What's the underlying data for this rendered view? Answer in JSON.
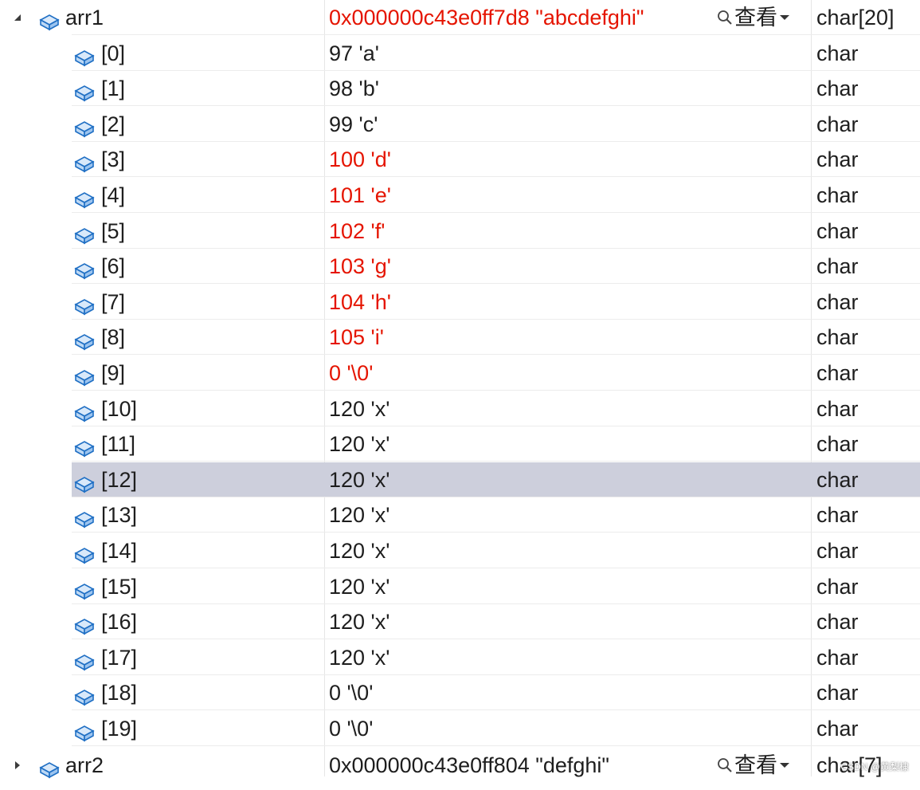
{
  "parent": {
    "name": "arr1",
    "value": "0x000000c43e0ff7d8 \"abcdefghi\"",
    "view_label": "查看",
    "type": "char[20]",
    "expanded": true
  },
  "children": [
    {
      "name": "[0]",
      "value": "97 'a'",
      "type": "char",
      "changed": false
    },
    {
      "name": "[1]",
      "value": "98 'b'",
      "type": "char",
      "changed": false
    },
    {
      "name": "[2]",
      "value": "99 'c'",
      "type": "char",
      "changed": false
    },
    {
      "name": "[3]",
      "value": "100 'd'",
      "type": "char",
      "changed": true
    },
    {
      "name": "[4]",
      "value": "101 'e'",
      "type": "char",
      "changed": true
    },
    {
      "name": "[5]",
      "value": "102 'f'",
      "type": "char",
      "changed": true
    },
    {
      "name": "[6]",
      "value": "103 'g'",
      "type": "char",
      "changed": true
    },
    {
      "name": "[7]",
      "value": "104 'h'",
      "type": "char",
      "changed": true
    },
    {
      "name": "[8]",
      "value": "105 'i'",
      "type": "char",
      "changed": true
    },
    {
      "name": "[9]",
      "value": "0 '\\0'",
      "type": "char",
      "changed": true
    },
    {
      "name": "[10]",
      "value": "120 'x'",
      "type": "char",
      "changed": false
    },
    {
      "name": "[11]",
      "value": "120 'x'",
      "type": "char",
      "changed": false
    },
    {
      "name": "[12]",
      "value": "120 'x'",
      "type": "char",
      "changed": false,
      "selected": true
    },
    {
      "name": "[13]",
      "value": "120 'x'",
      "type": "char",
      "changed": false
    },
    {
      "name": "[14]",
      "value": "120 'x'",
      "type": "char",
      "changed": false
    },
    {
      "name": "[15]",
      "value": "120 'x'",
      "type": "char",
      "changed": false
    },
    {
      "name": "[16]",
      "value": "120 'x'",
      "type": "char",
      "changed": false
    },
    {
      "name": "[17]",
      "value": "120 'x'",
      "type": "char",
      "changed": false
    },
    {
      "name": "[18]",
      "value": "0 '\\0'",
      "type": "char",
      "changed": false
    },
    {
      "name": "[19]",
      "value": "0 '\\0'",
      "type": "char",
      "changed": false
    }
  ],
  "next": {
    "name": "arr2",
    "value": "0x000000c43e0ff804 \"defghi\"",
    "view_label": "查看",
    "type": "char[7]",
    "expanded": false
  },
  "watermark": "CSDN @黄梨棣",
  "colors": {
    "changed_value": "#e51400",
    "selection": "#cdcfdc",
    "icon_fill": "#bcd8f5",
    "icon_stroke": "#1f6fc4"
  },
  "icons": {
    "variable": "field-cube-icon",
    "search": "magnifier-icon",
    "dropdown": "caret-down-icon",
    "expanded": "triangle-expanded-icon",
    "collapsed": "triangle-collapsed-icon"
  }
}
